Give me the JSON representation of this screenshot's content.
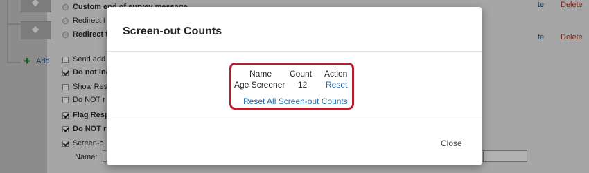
{
  "background": {
    "add_label": "Add",
    "options": [
      {
        "type": "radio",
        "label": "Custom end of survey message",
        "bold": true
      },
      {
        "type": "radio",
        "label": "Redirect t",
        "bold": false
      },
      {
        "type": "radio",
        "label": "Redirect t",
        "bold": true
      },
      {
        "type": "checkbox",
        "checked": false,
        "label": "Send add",
        "bold": false
      },
      {
        "type": "checkbox",
        "checked": true,
        "label": "Do not inc",
        "bold": true
      },
      {
        "type": "checkbox",
        "checked": false,
        "label": "Show Res",
        "bold": false
      },
      {
        "type": "checkbox",
        "checked": false,
        "label": "Do NOT r",
        "bold": false
      },
      {
        "type": "checkbox",
        "checked": true,
        "label": "Flag Resp",
        "bold": true
      },
      {
        "type": "checkbox",
        "checked": true,
        "label": "Do NOT r",
        "bold": true
      },
      {
        "type": "checkbox",
        "checked": true,
        "label": "Screen-o",
        "bold": false
      }
    ],
    "name_label": "Name:",
    "edit_label": "te",
    "delete_label": "Delete"
  },
  "modal": {
    "title": "Screen-out Counts",
    "headers": {
      "name": "Name",
      "count": "Count",
      "action": "Action"
    },
    "rows": [
      {
        "name": "Age Screener",
        "count": "12",
        "action": "Reset"
      }
    ],
    "reset_all_label": "Reset All Screen-out Counts",
    "close_label": "Close"
  }
}
